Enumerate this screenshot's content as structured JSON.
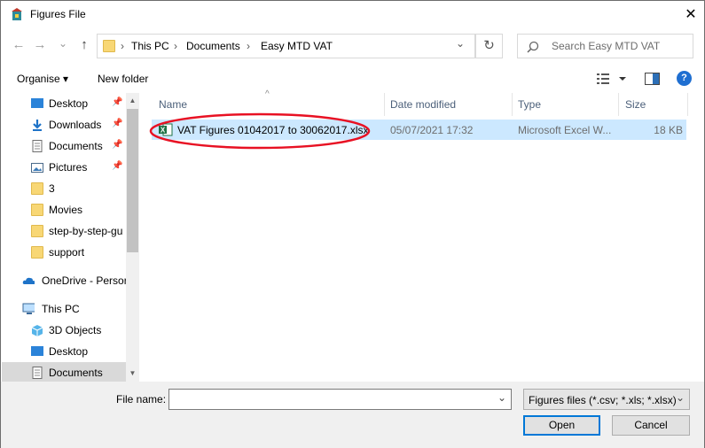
{
  "window": {
    "title": "Figures File",
    "close_glyph": "✕"
  },
  "nav": {
    "back_glyph": "←",
    "forward_glyph": "→",
    "dropdown_glyph": "⌄",
    "up_glyph": "↑",
    "breadcrumb": [
      "This PC",
      "Documents",
      "Easy MTD VAT"
    ],
    "separator": "›",
    "refresh_glyph": "↻",
    "search_placeholder": "Search Easy MTD VAT"
  },
  "toolbar": {
    "organise": "Organise ▾",
    "new_folder": "New folder",
    "help": "?"
  },
  "sidebar": {
    "items": [
      {
        "label": "Desktop",
        "icon": "desktop-icon",
        "pinned": true
      },
      {
        "label": "Downloads",
        "icon": "downloads-icon",
        "pinned": true
      },
      {
        "label": "Documents",
        "icon": "documents-icon",
        "pinned": true
      },
      {
        "label": "Pictures",
        "icon": "pictures-icon",
        "pinned": true
      },
      {
        "label": "3",
        "icon": "folder-icon",
        "pinned": false
      },
      {
        "label": "Movies",
        "icon": "folder-icon",
        "pinned": false
      },
      {
        "label": "step-by-step-gu",
        "icon": "folder-icon",
        "pinned": false
      },
      {
        "label": "support",
        "icon": "folder-icon",
        "pinned": false
      },
      {
        "label": "OneDrive - Persor",
        "icon": "onedrive-icon",
        "pinned": false
      },
      {
        "label": "This PC",
        "icon": "thispc-icon",
        "pinned": false
      },
      {
        "label": "3D Objects",
        "icon": "3d-objects-icon",
        "pinned": false
      },
      {
        "label": "Desktop",
        "icon": "desktop-icon",
        "pinned": false
      },
      {
        "label": "Documents",
        "icon": "documents-icon",
        "pinned": false,
        "selected": true
      }
    ],
    "pin_glyph": "📌"
  },
  "columns": {
    "name": "Name",
    "date": "Date modified",
    "type": "Type",
    "size": "Size",
    "sort_glyph": "^"
  },
  "files": [
    {
      "name": "VAT Figures 01042017 to 30062017.xlsx",
      "date": "05/07/2021 17:32",
      "type": "Microsoft Excel W...",
      "size": "18 KB"
    }
  ],
  "bottom": {
    "file_name_label": "File name:",
    "file_name_value": "",
    "filter": "Figures files (*.csv; *.xls; *.xlsx)",
    "open": "Open",
    "cancel": "Cancel"
  },
  "colors": {
    "selection": "#cce8ff",
    "highlight_ellipse": "#e81123",
    "accent": "#0078d7"
  }
}
